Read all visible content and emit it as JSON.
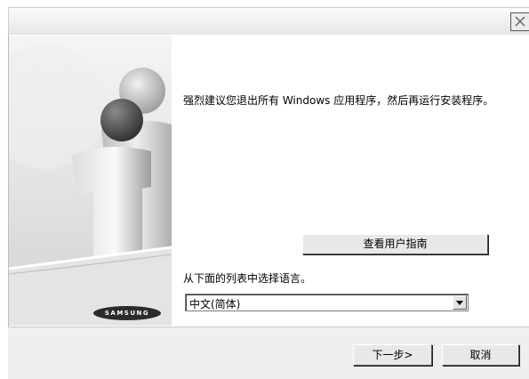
{
  "window": {
    "close_glyph": "✕"
  },
  "main": {
    "message": "强烈建议您退出所有 Windows 应用程序，然后再运行安装程序。",
    "guide_button": "查看用户指南",
    "language_label": "从下面的列表中选择语言。",
    "language_selected": "中文(简体)"
  },
  "branding": {
    "logo_text": "SAMSUNG"
  },
  "footer": {
    "next_button": "下一步>",
    "cancel_button": "取消"
  },
  "colors": {
    "titlebar": "#e6e6e6",
    "footer": "#efefef",
    "button_face": "#e8e8e8"
  }
}
